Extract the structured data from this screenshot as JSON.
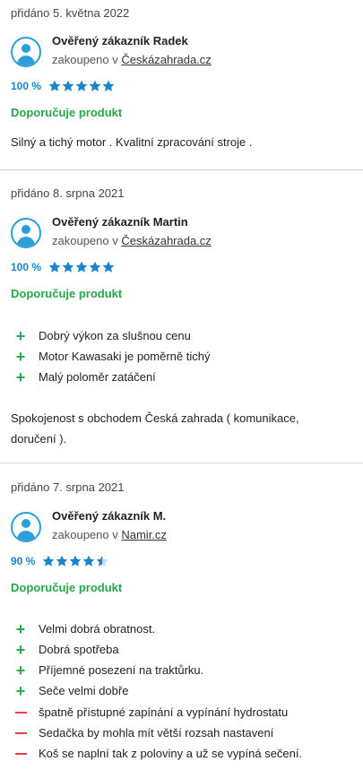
{
  "reviews": [
    {
      "date": "přidáno 5. května 2022",
      "author": "Ověřený zákazník Radek",
      "bought_prefix": "zakoupeno v",
      "shop": "Českázahrada.cz",
      "percent": "100 %",
      "stars": 5,
      "recommend": "Doporučuje produkt",
      "text": "Silný a tichý motor . Kvalitní zpracování stroje ."
    },
    {
      "date": "přidáno 8. srpna 2021",
      "author": "Ověřený zákazník Martin",
      "bought_prefix": "zakoupeno v",
      "shop": "Českázahrada.cz",
      "percent": "100 %",
      "stars": 5,
      "recommend": "Doporučuje produkt",
      "pros": [
        "Dobrý výkon za slušnou cenu",
        "Motor Kawasaki je poměrně tichý",
        "Malý poloměr zatáčení"
      ],
      "text": "Spokojenost s obchodem Česká zahrada ( komunikace, doručení )."
    },
    {
      "date": "přidáno 7. srpna 2021",
      "author": "Ověřený zákazník M.",
      "bought_prefix": "zakoupeno v",
      "shop": "Namir.cz",
      "percent": "90 %",
      "stars": 4.5,
      "recommend": "Doporučuje produkt",
      "pros": [
        "Velmi dobrá obratnost.",
        "Dobrá spotřeba",
        "Příjemné posezení na traktůrku.",
        "Seče velmi dobře"
      ],
      "cons": [
        "špatně přístupné zapínání a vypínání hydrostatu",
        "Sedačka by mohla mít větší rozsah nastavení",
        "Koš se naplní tak z poloviny a už se vypíná sečení."
      ]
    }
  ],
  "colors": {
    "star": "#1a86c9",
    "star_empty": "#c9d9e6",
    "recommend": "#27a54a",
    "plus": "#2fa84f",
    "minus": "#e0434d",
    "avatar": "#2a9fd8"
  },
  "icons": {
    "avatar": "user-avatar-icon",
    "star": "star-icon",
    "plus": "plus-icon",
    "minus": "minus-icon"
  }
}
